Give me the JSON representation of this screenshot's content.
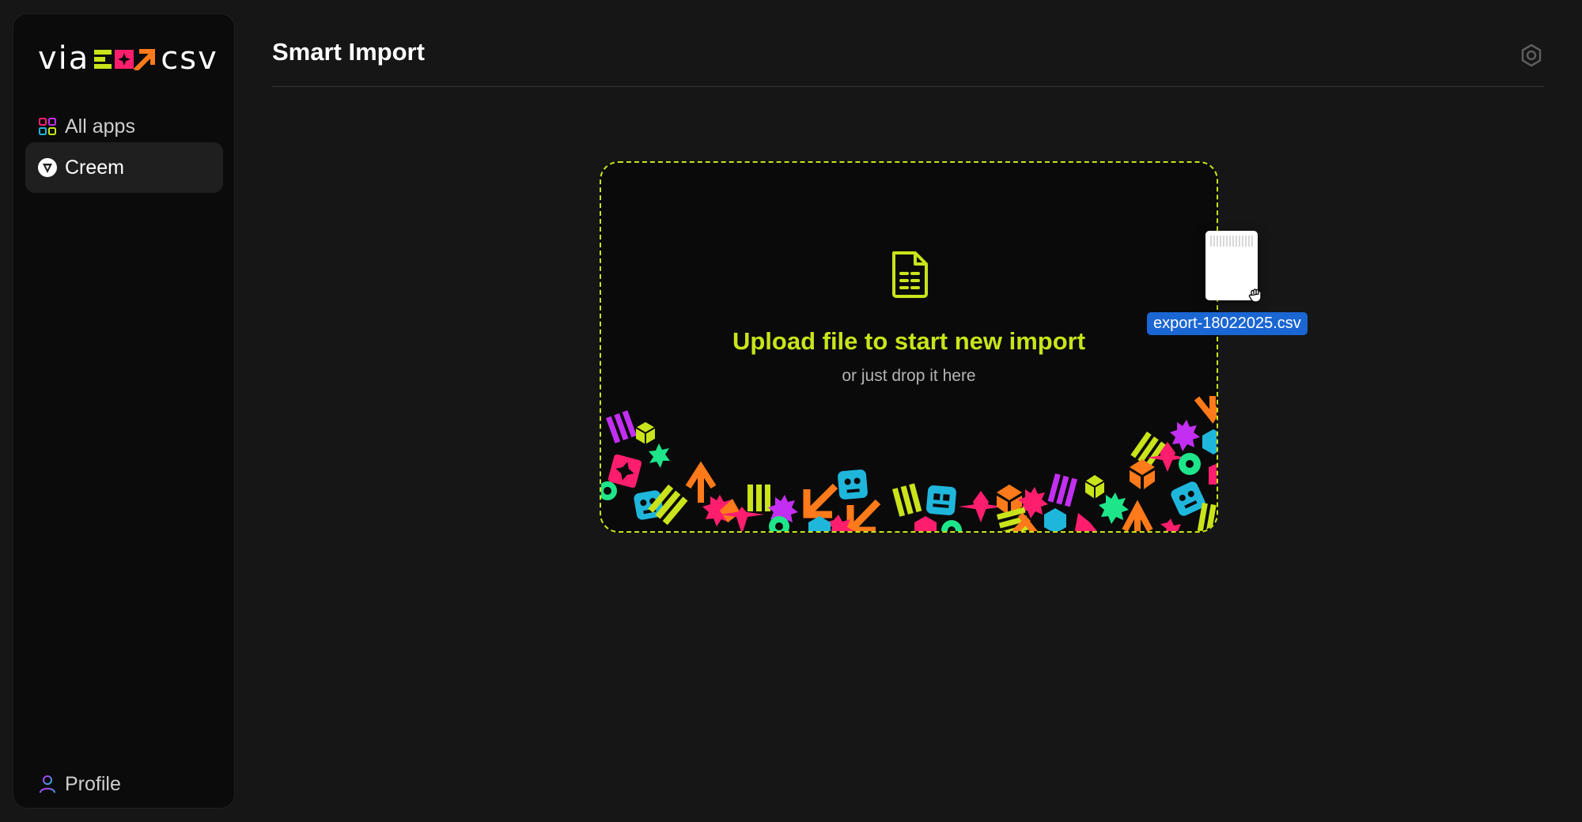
{
  "app": {
    "logo_left": "via",
    "logo_right": "csv"
  },
  "sidebar": {
    "items": [
      {
        "label": "All apps",
        "icon": "grid-icon"
      },
      {
        "label": "Creem",
        "icon": "creem-logo-icon"
      }
    ],
    "profile": {
      "label": "Profile",
      "icon": "user-icon"
    }
  },
  "header": {
    "title": "Smart Import",
    "settings_icon": "gear-icon"
  },
  "dropzone": {
    "title": "Upload file to start new import",
    "subtitle": "or just drop it here",
    "icon": "file-spreadsheet-icon",
    "accent_color": "#c9e41a"
  },
  "drag": {
    "filename": "export-18022025.csv"
  },
  "colors": {
    "accent": "#c9e41a",
    "pink": "#ff1e6e",
    "orange": "#ff7a1a",
    "cyan": "#1fb6dc",
    "purple": "#c32ff2",
    "green": "#1ee58a",
    "selection": "#1a66d2"
  }
}
